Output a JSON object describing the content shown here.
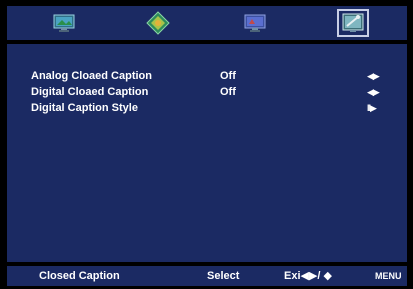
{
  "tabs": [
    {
      "name": "picture-icon",
      "selected": false
    },
    {
      "name": "sound-icon",
      "selected": false
    },
    {
      "name": "channel-icon",
      "selected": false
    },
    {
      "name": "setup-icon",
      "selected": true
    }
  ],
  "menu": {
    "items": [
      {
        "label": "Analog Cloaed Caption",
        "value": "Off",
        "nav": "◀▶"
      },
      {
        "label": "Digital Cloaed Caption",
        "value": "Off",
        "nav": "◀▶"
      },
      {
        "label": "Digital Caption Style",
        "value": "",
        "nav": "II▶"
      }
    ]
  },
  "footer": {
    "title": "Closed Caption",
    "select": "Select",
    "exit": "Exi◀▶/ ◆",
    "menu": "MENU"
  }
}
